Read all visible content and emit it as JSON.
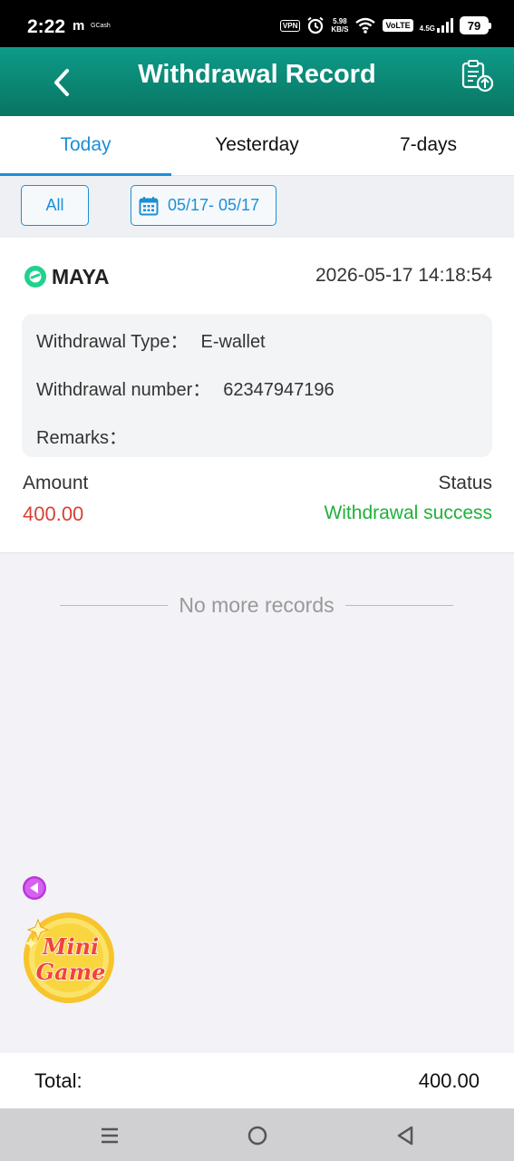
{
  "status_bar": {
    "time": "2:22",
    "app_m": "m",
    "app_gcash": "GCash",
    "vpn": "VPN",
    "speed_value": "5.98",
    "speed_unit": "KB/S",
    "volte": "VoLTE",
    "network": "4.5G",
    "battery": "79"
  },
  "header": {
    "title": "Withdrawal Record"
  },
  "tabs": [
    {
      "label": "Today",
      "active": true
    },
    {
      "label": "Yesterday",
      "active": false
    },
    {
      "label": "7-days",
      "active": false
    }
  ],
  "filters": {
    "all_label": "All",
    "date_range": "05/17- 05/17"
  },
  "record": {
    "provider": "MAYA",
    "datetime": "2026-05-17 14:18:54",
    "type_label": "Withdrawal Type：",
    "type_value": "E-wallet",
    "number_label": "Withdrawal number：",
    "number_value": "62347947196",
    "remarks_label": "Remarks：",
    "remarks_value": "",
    "amount_label": "Amount",
    "amount_value": "400.00",
    "status_label": "Status",
    "status_value": "Withdrawal success"
  },
  "list_footer": {
    "no_more": "No more records"
  },
  "floating": {
    "minigame_line1": "Mini",
    "minigame_line2": "Game"
  },
  "total": {
    "label": "Total:",
    "value": "400.00"
  },
  "colors": {
    "header": "#0b8a76",
    "accent": "#1b8fd6",
    "amount": "#d94135",
    "success": "#1fb13a"
  },
  "icons": {
    "back": "chevron-left-icon",
    "record": "clipboard-upload-icon",
    "calendar": "calendar-icon",
    "maya": "maya-logo-icon",
    "collapse": "triangle-left-icon",
    "nav_menu": "menu-icon",
    "nav_home": "home-icon",
    "nav_back": "back-icon"
  }
}
